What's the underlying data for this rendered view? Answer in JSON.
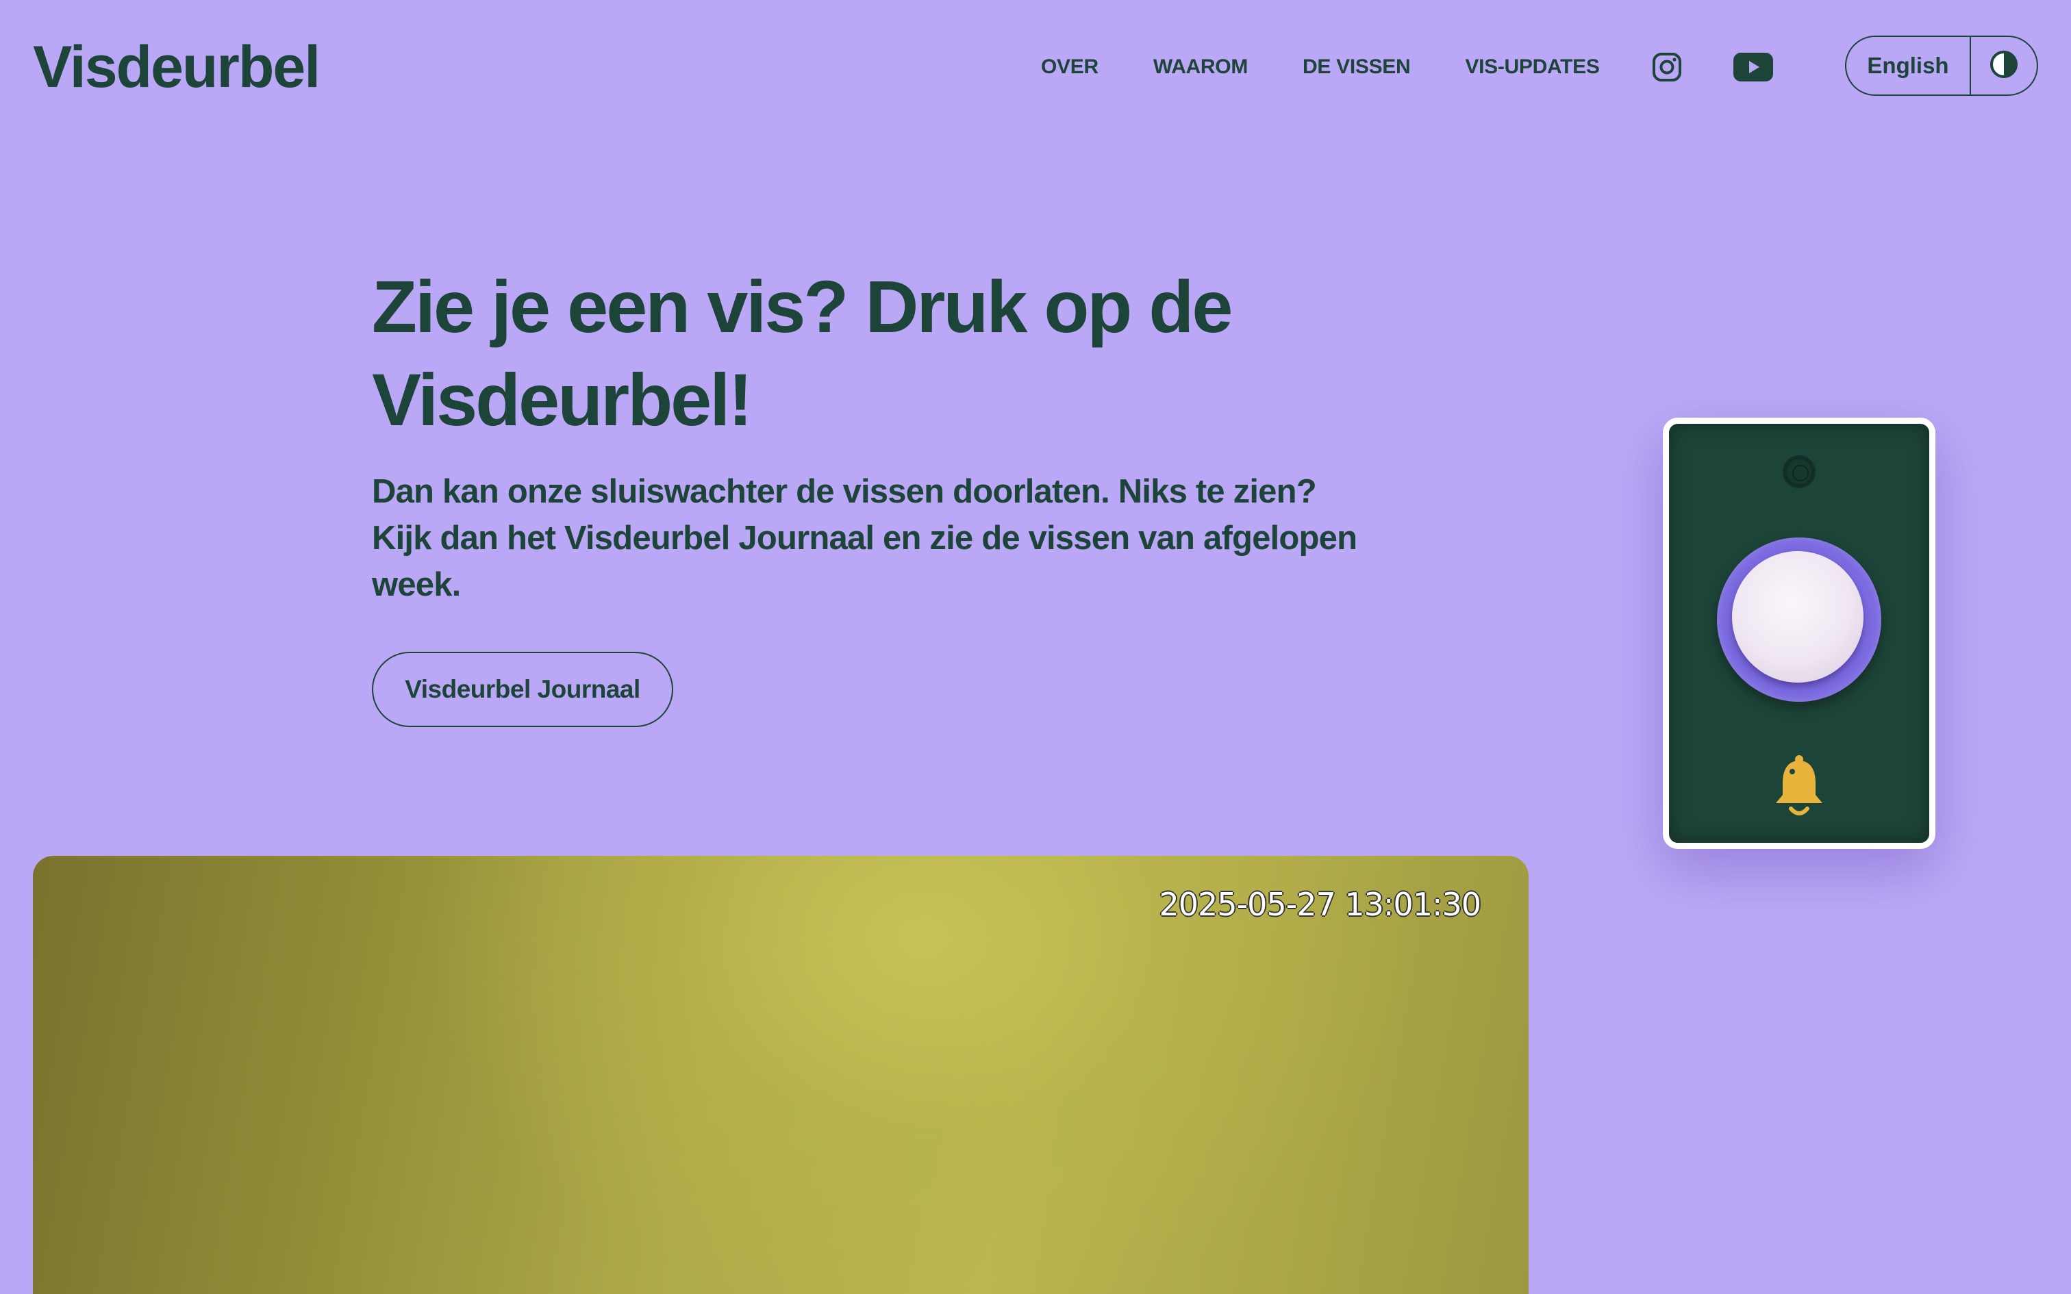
{
  "header": {
    "logo": "Visdeurbel",
    "nav": [
      {
        "label": "OVER"
      },
      {
        "label": "WAAROM"
      },
      {
        "label": "DE VISSEN"
      },
      {
        "label": "VIS-UPDATES"
      }
    ],
    "social": [
      {
        "icon": "instagram-icon"
      },
      {
        "icon": "youtube-icon"
      }
    ],
    "language_label": "English",
    "contrast_icon": "contrast-icon"
  },
  "hero": {
    "title": "Zie je een vis? Druk op de Visdeurbel!",
    "text": "Dan kan onze sluiswachter de vissen doorlaten. Niks te zien? Kijk dan het Visdeurbel Journaal en zie de vissen van afgelopen week.",
    "cta_label": "Visdeurbel Journaal"
  },
  "video": {
    "timestamp": "2025-05-27 13:01:30"
  },
  "colors": {
    "background": "#baa8f7",
    "text": "#1d4438",
    "doorbell_body": "#1d4438",
    "doorbell_ring": "#7b6ae0",
    "bell_icon": "#e8b43c"
  }
}
